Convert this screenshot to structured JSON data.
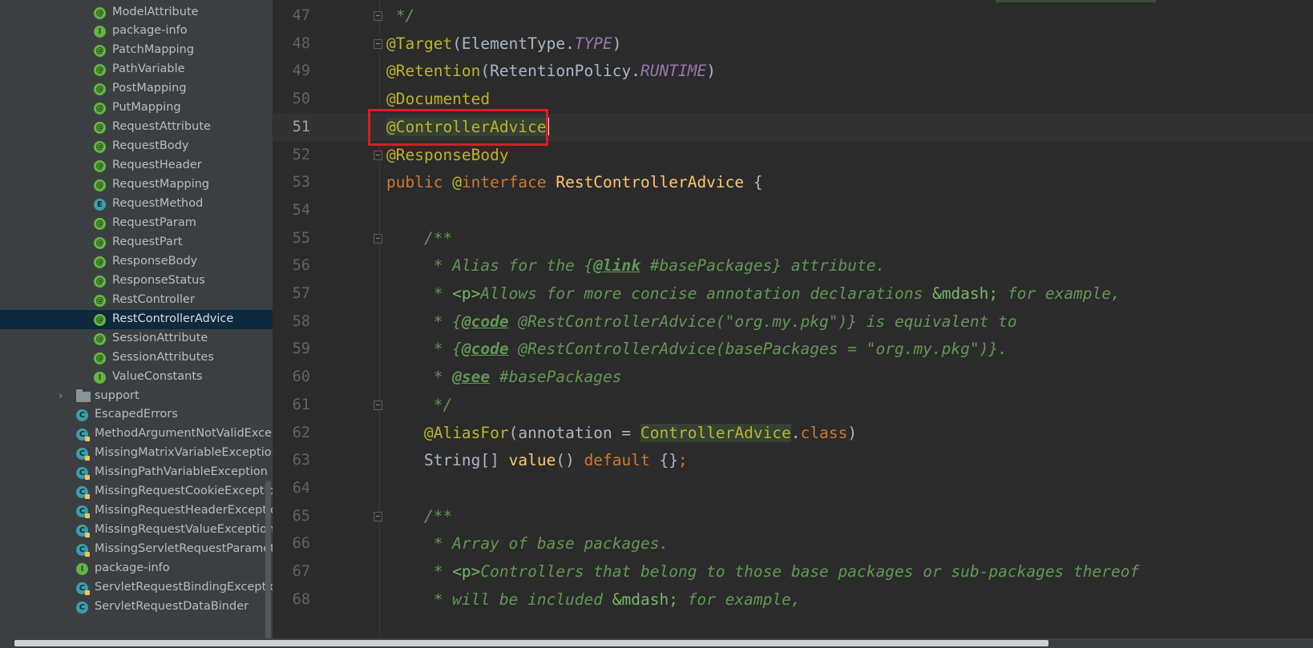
{
  "sidebar": {
    "items": [
      {
        "label": "ModelAttribute",
        "icon": "annotation-icon",
        "glyph": "@",
        "indent": 1
      },
      {
        "label": "package-info",
        "icon": "package-info-icon",
        "glyph": "I",
        "indent": 1
      },
      {
        "label": "PatchMapping",
        "icon": "annotation-icon",
        "glyph": "@",
        "indent": 1
      },
      {
        "label": "PathVariable",
        "icon": "annotation-icon",
        "glyph": "@",
        "indent": 1
      },
      {
        "label": "PostMapping",
        "icon": "annotation-icon",
        "glyph": "@",
        "indent": 1
      },
      {
        "label": "PutMapping",
        "icon": "annotation-icon",
        "glyph": "@",
        "indent": 1
      },
      {
        "label": "RequestAttribute",
        "icon": "annotation-icon",
        "glyph": "@",
        "indent": 1
      },
      {
        "label": "RequestBody",
        "icon": "annotation-icon",
        "glyph": "@",
        "indent": 1
      },
      {
        "label": "RequestHeader",
        "icon": "annotation-icon",
        "glyph": "@",
        "indent": 1
      },
      {
        "label": "RequestMapping",
        "icon": "annotation-icon",
        "glyph": "@",
        "indent": 1
      },
      {
        "label": "RequestMethod",
        "icon": "enum-icon",
        "glyph": "E",
        "indent": 1
      },
      {
        "label": "RequestParam",
        "icon": "annotation-icon",
        "glyph": "@",
        "indent": 1
      },
      {
        "label": "RequestPart",
        "icon": "annotation-icon",
        "glyph": "@",
        "indent": 1
      },
      {
        "label": "ResponseBody",
        "icon": "annotation-icon",
        "glyph": "@",
        "indent": 1
      },
      {
        "label": "ResponseStatus",
        "icon": "annotation-icon",
        "glyph": "@",
        "indent": 1
      },
      {
        "label": "RestController",
        "icon": "annotation-icon",
        "glyph": "@",
        "indent": 1
      },
      {
        "label": "RestControllerAdvice",
        "icon": "annotation-icon",
        "glyph": "@",
        "indent": 1,
        "selected": true
      },
      {
        "label": "SessionAttribute",
        "icon": "annotation-icon",
        "glyph": "@",
        "indent": 1
      },
      {
        "label": "SessionAttributes",
        "icon": "annotation-icon",
        "glyph": "@",
        "indent": 1
      },
      {
        "label": "ValueConstants",
        "icon": "package-info-icon",
        "glyph": "I",
        "indent": 1
      },
      {
        "label": "support",
        "icon": "folder-icon",
        "glyph": "",
        "indent": 0,
        "folder": true
      },
      {
        "label": "EscapedErrors",
        "icon": "class-icon",
        "glyph": "C",
        "indent": 0
      },
      {
        "label": "MethodArgumentNotValidExcept",
        "icon": "exception-class-icon",
        "glyph": "C",
        "indent": 0
      },
      {
        "label": "MissingMatrixVariableException",
        "icon": "exception-class-icon",
        "glyph": "C",
        "indent": 0
      },
      {
        "label": "MissingPathVariableException",
        "icon": "exception-class-icon",
        "glyph": "C",
        "indent": 0
      },
      {
        "label": "MissingRequestCookieException",
        "icon": "exception-class-icon",
        "glyph": "C",
        "indent": 0
      },
      {
        "label": "MissingRequestHeaderException",
        "icon": "exception-class-icon",
        "glyph": "C",
        "indent": 0
      },
      {
        "label": "MissingRequestValueException",
        "icon": "exception-class-icon",
        "glyph": "C",
        "indent": 0
      },
      {
        "label": "MissingServletRequestParameterE",
        "icon": "exception-class-icon",
        "glyph": "C",
        "indent": 0
      },
      {
        "label": "package-info",
        "icon": "package-info-icon",
        "glyph": "I",
        "indent": 0
      },
      {
        "label": "ServletRequestBindingException",
        "icon": "exception-class-icon",
        "glyph": "C",
        "indent": 0
      },
      {
        "label": "ServletRequestDataBinder",
        "icon": "class-icon",
        "glyph": "C",
        "indent": 0
      }
    ]
  },
  "editor": {
    "current_line": "51",
    "lines": [
      {
        "n": "47",
        "fold": true,
        "tokens": [
          {
            "t": " */",
            "c": "cmt"
          }
        ]
      },
      {
        "n": "48",
        "fold": true,
        "tokens": [
          {
            "t": "@Target",
            "c": "an"
          },
          {
            "t": "(ElementType.",
            "c": "pl"
          },
          {
            "t": "TYPE",
            "c": "cst"
          },
          {
            "t": ")",
            "c": "pl"
          }
        ]
      },
      {
        "n": "49",
        "tokens": [
          {
            "t": "@Retention",
            "c": "an"
          },
          {
            "t": "(RetentionPolicy.",
            "c": "pl"
          },
          {
            "t": "RUNTIME",
            "c": "cst"
          },
          {
            "t": ")",
            "c": "pl"
          }
        ]
      },
      {
        "n": "50",
        "tokens": [
          {
            "t": "@Documented",
            "c": "an"
          }
        ]
      },
      {
        "n": "51",
        "current": true,
        "tokens": [
          {
            "t": "@ControllerAdvice",
            "c": "an hl"
          }
        ]
      },
      {
        "n": "52",
        "fold": true,
        "tokens": [
          {
            "t": "@ResponseBody",
            "c": "an"
          }
        ]
      },
      {
        "n": "53",
        "tokens": [
          {
            "t": "public ",
            "c": "kw"
          },
          {
            "t": "@",
            "c": "an"
          },
          {
            "t": "interface ",
            "c": "kw"
          },
          {
            "t": "RestControllerAdvice",
            "c": "ty"
          },
          {
            "t": " {",
            "c": "pl"
          }
        ]
      },
      {
        "n": "54",
        "tokens": []
      },
      {
        "n": "55",
        "fold": true,
        "tokens": [
          {
            "t": "    /**",
            "c": "cmt"
          }
        ]
      },
      {
        "n": "56",
        "tokens": [
          {
            "t": "     * Alias for the {",
            "c": "cmt"
          },
          {
            "t": "@link",
            "c": "cmt-tag"
          },
          {
            "t": " #basePackages} attribute.",
            "c": "cmt"
          }
        ]
      },
      {
        "n": "57",
        "tokens": [
          {
            "t": "     * ",
            "c": "cmt"
          },
          {
            "t": "<p>",
            "c": "cmt-html"
          },
          {
            "t": "Allows for more concise annotation declarations ",
            "c": "cmt"
          },
          {
            "t": "&mdash;",
            "c": "cmt-html"
          },
          {
            "t": " for example,",
            "c": "cmt"
          }
        ]
      },
      {
        "n": "58",
        "tokens": [
          {
            "t": "     * {",
            "c": "cmt"
          },
          {
            "t": "@code",
            "c": "cmt-tag"
          },
          {
            "t": " @RestControllerAdvice(\"org.my.pkg\")} is equivalent to",
            "c": "cmt"
          }
        ]
      },
      {
        "n": "59",
        "tokens": [
          {
            "t": "     * {",
            "c": "cmt"
          },
          {
            "t": "@code",
            "c": "cmt-tag"
          },
          {
            "t": " @RestControllerAdvice(basePackages = \"org.my.pkg\")}.",
            "c": "cmt"
          }
        ]
      },
      {
        "n": "60",
        "tokens": [
          {
            "t": "     * ",
            "c": "cmt"
          },
          {
            "t": "@see",
            "c": "cmt-tag"
          },
          {
            "t": " #basePackages",
            "c": "cmt"
          }
        ]
      },
      {
        "n": "61",
        "fold": true,
        "tokens": [
          {
            "t": "     */",
            "c": "cmt"
          }
        ]
      },
      {
        "n": "62",
        "tokens": [
          {
            "t": "    ",
            "c": "pl"
          },
          {
            "t": "@AliasFor",
            "c": "an"
          },
          {
            "t": "(annotation = ",
            "c": "pl"
          },
          {
            "t": "ControllerAdvice",
            "c": "an hl"
          },
          {
            "t": ".",
            "c": "pl"
          },
          {
            "t": "class",
            "c": "kw"
          },
          {
            "t": ")",
            "c": "pl"
          }
        ]
      },
      {
        "n": "63",
        "tokens": [
          {
            "t": "    String[] ",
            "c": "pl"
          },
          {
            "t": "value",
            "c": "ty"
          },
          {
            "t": "() ",
            "c": "pl"
          },
          {
            "t": "default",
            "c": "kw"
          },
          {
            "t": " {}",
            "c": "pl"
          },
          {
            "t": ";",
            "c": "kw"
          }
        ]
      },
      {
        "n": "64",
        "tokens": []
      },
      {
        "n": "65",
        "fold": true,
        "tokens": [
          {
            "t": "    /**",
            "c": "cmt"
          }
        ]
      },
      {
        "n": "66",
        "tokens": [
          {
            "t": "     * Array of base packages.",
            "c": "cmt"
          }
        ]
      },
      {
        "n": "67",
        "tokens": [
          {
            "t": "     * ",
            "c": "cmt"
          },
          {
            "t": "<p>",
            "c": "cmt-html"
          },
          {
            "t": "Controllers that belong to those base packages or sub-packages thereof",
            "c": "cmt"
          }
        ]
      },
      {
        "n": "68",
        "tokens": [
          {
            "t": "     * will be included ",
            "c": "cmt"
          },
          {
            "t": "&mdash;",
            "c": "cmt-html"
          },
          {
            "t": " for example,",
            "c": "cmt"
          }
        ]
      }
    ]
  },
  "colors": {
    "background": "#2b2b2b",
    "sidebar": "#3c3f41",
    "selection": "#0d293e",
    "annotation": "#bbb529",
    "keyword": "#cc7832",
    "comment": "#629755",
    "highlight_border": "#e01b24"
  }
}
